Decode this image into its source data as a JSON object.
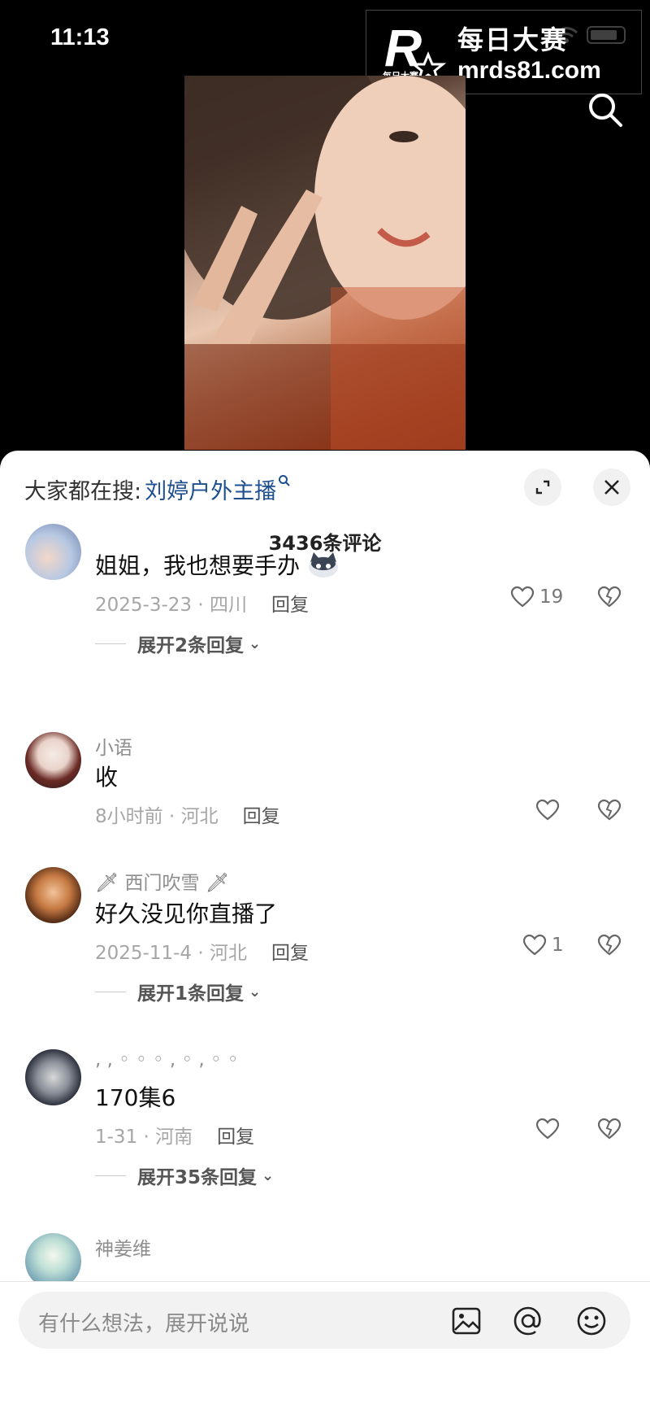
{
  "status_bar": {
    "time": "11:13"
  },
  "watermark": {
    "title": "每日大赛",
    "url": "mrds81.com",
    "logo_letter": "R",
    "logo_caption": "每日大赛"
  },
  "sheet": {
    "hot_search_prefix": "大家都在搜:",
    "hot_search_term": "刘婷户外主播",
    "comment_count": "3436条评论"
  },
  "comments": [
    {
      "username": "",
      "text": "姐姐，我也想要手办",
      "meta": "2025-3-23 · 四川",
      "reply": "回复",
      "likes": "19",
      "expand": "展开2条回复"
    },
    {
      "username": "小语",
      "text": "收",
      "meta": "8小时前 · 河北",
      "reply": "回复",
      "likes": "",
      "expand": ""
    },
    {
      "username": "西门吹雪",
      "text": "好久没见你直播了",
      "meta": "2025-11-4 · 河北",
      "reply": "回复",
      "likes": "1",
      "expand": "展开1条回复"
    },
    {
      "username": ", , ◦ ◦ ◦ , ◦ , ◦ ◦",
      "text": "170集6",
      "meta": "1-31 · 河南",
      "reply": "回复",
      "likes": "",
      "expand": "展开35条回复"
    },
    {
      "username": "神姜维",
      "text": "",
      "meta": "",
      "reply": "",
      "likes": "",
      "expand": ""
    }
  ],
  "input": {
    "placeholder": "有什么想法，展开说说"
  },
  "icons": [
    "search-icon",
    "expand-icon",
    "close-icon",
    "heart-icon",
    "broken-heart-icon",
    "image-icon",
    "at-icon",
    "emoji-icon",
    "wifi-icon",
    "battery-icon"
  ]
}
